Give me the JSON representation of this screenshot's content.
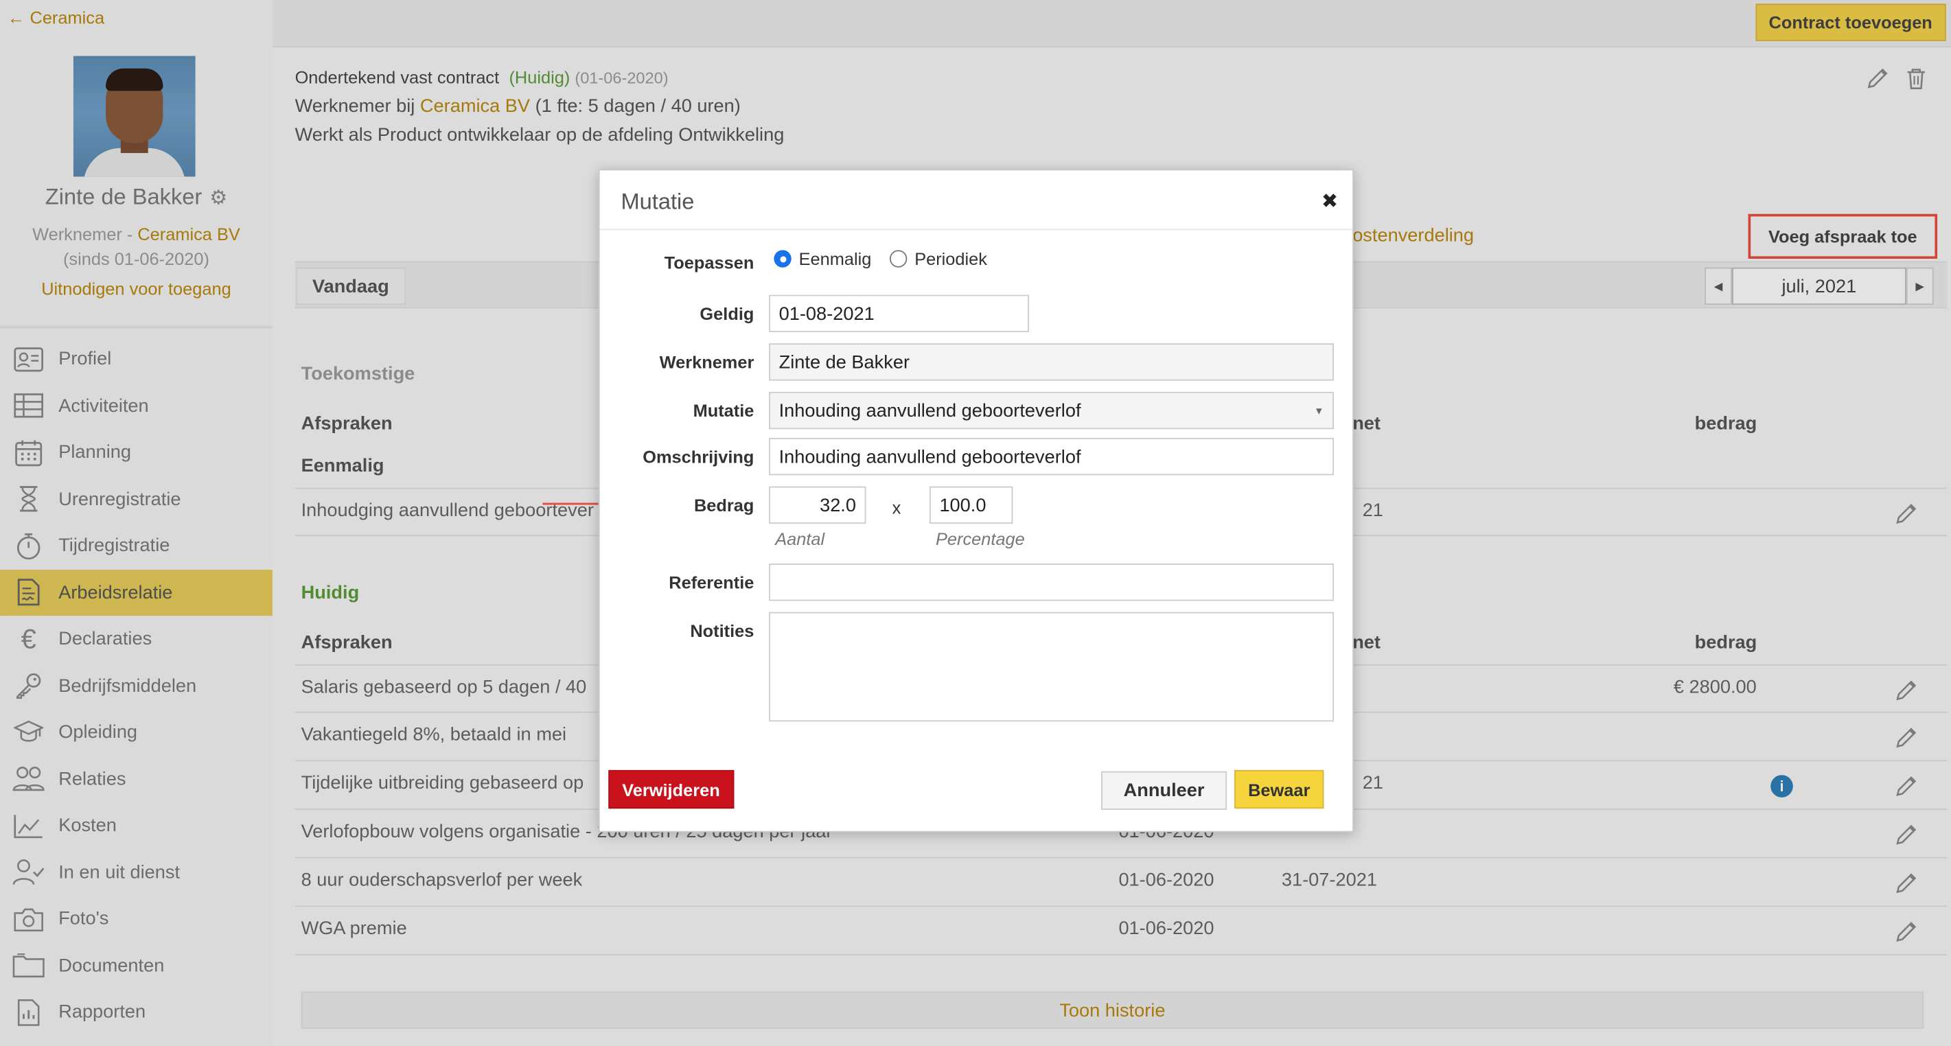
{
  "sidebar": {
    "back_label": "Ceramica",
    "user_name": "Zinte de Bakker",
    "role": "Werknemer - ",
    "company": "Ceramica BV",
    "since": "(sinds 01-06-2020)",
    "invite": "Uitnodigen voor toegang",
    "nav": [
      {
        "label": "Profiel",
        "icon": "profile-card-icon"
      },
      {
        "label": "Activiteiten",
        "icon": "table-icon"
      },
      {
        "label": "Planning",
        "icon": "calendar-icon"
      },
      {
        "label": "Urenregistratie",
        "icon": "hourglass-icon"
      },
      {
        "label": "Tijdregistratie",
        "icon": "stopwatch-icon"
      },
      {
        "label": "Arbeidsrelatie",
        "icon": "contract-icon",
        "active": true
      },
      {
        "label": "Declaraties",
        "icon": "euro-icon"
      },
      {
        "label": "Bedrijfsmiddelen",
        "icon": "key-icon"
      },
      {
        "label": "Opleiding",
        "icon": "graduation-icon"
      },
      {
        "label": "Relaties",
        "icon": "people-icon"
      },
      {
        "label": "Kosten",
        "icon": "area-chart-icon"
      },
      {
        "label": "In en uit dienst",
        "icon": "user-check-icon"
      },
      {
        "label": "Foto's",
        "icon": "camera-icon"
      },
      {
        "label": "Documenten",
        "icon": "folder-icon"
      },
      {
        "label": "Rapporten",
        "icon": "report-icon"
      }
    ]
  },
  "header": {
    "contract_button": "Contract toevoegen"
  },
  "contract": {
    "title": "Ondertekend vast contract",
    "status": "(Huidig)",
    "date": "(01-06-2020)",
    "line1_prefix": "Werknemer bij ",
    "line1_company": "Ceramica BV",
    "line1_suffix": " (1 fte: 5 dagen / 40 uren)",
    "line2": "Werkt als Product ontwikkelaar op de afdeling Ontwikkeling"
  },
  "tabs": {
    "kostenverdeling_fragment": "ostenverdeling",
    "add_agreement": "Voeg afspraak toe",
    "today": "Vandaag",
    "month": "juli, 2021"
  },
  "future": {
    "title": "Toekomstige",
    "col_afspraken": "Afspraken",
    "col_tot_fragment": "net",
    "col_bedrag": "bedrag",
    "subtitle": "Eenmalig",
    "rows": [
      {
        "text": "Inhoudging aanvullend geboortever",
        "c2": "21"
      }
    ]
  },
  "current": {
    "title": "Huidig",
    "col_afspraken": "Afspraken",
    "col_tot_fragment": "net",
    "col_bedrag": "bedrag",
    "rows": [
      {
        "text": "Salaris gebaseerd op 5 dagen / 40",
        "c1": "",
        "c2": "",
        "amount": "€ 2800.00"
      },
      {
        "text": "Vakantiegeld 8%, betaald in mei",
        "c1": "",
        "c2": "",
        "amount": ""
      },
      {
        "text": "Tijdelijke uitbreiding gebaseerd op",
        "c1": "",
        "c2": "21",
        "amount": "",
        "info": true
      },
      {
        "text": "Verlofopbouw volgens organisatie - 200 uren / 25 dagen per jaar",
        "c1": "01-06-2020",
        "c2": "",
        "amount": ""
      },
      {
        "text": "8 uur ouderschapsverlof per week",
        "c1": "01-06-2020",
        "c2": "31-07-2021",
        "amount": ""
      },
      {
        "text": "WGA premie",
        "c1": "01-06-2020",
        "c2": "",
        "amount": ""
      }
    ],
    "history_button": "Toon historie"
  },
  "modal": {
    "title": "Mutatie",
    "close_glyph": "✖",
    "labels": {
      "toepassen": "Toepassen",
      "geldig": "Geldig",
      "werknemer": "Werknemer",
      "mutatie": "Mutatie",
      "omschrijving": "Omschrijving",
      "bedrag": "Bedrag",
      "referentie": "Referentie",
      "notities": "Notities"
    },
    "radio_eenmalig": "Eenmalig",
    "radio_periodiek": "Periodiek",
    "selected_radio": "Eenmalig",
    "geldig": "01-08-2021",
    "werknemer": "Zinte de Bakker",
    "mutatie": "Inhouding aanvullend geboorteverlof",
    "omschrijving": "Inhouding aanvullend geboorteverlof",
    "aantal": "32.0",
    "times": "x",
    "percentage": "100.0",
    "aantal_hint": "Aantal",
    "percentage_hint": "Percentage",
    "referentie": "",
    "notities": "",
    "delete": "Verwijderen",
    "cancel": "Annuleer",
    "save": "Bewaar"
  },
  "colors": {
    "accent_yellow": "#f0cf4a",
    "active_nav": "#e3c85a",
    "link_gold": "#b8860b",
    "current_green": "#5a9a3a",
    "delete_red": "#c9121b",
    "annotation_red": "#e74c3c"
  }
}
